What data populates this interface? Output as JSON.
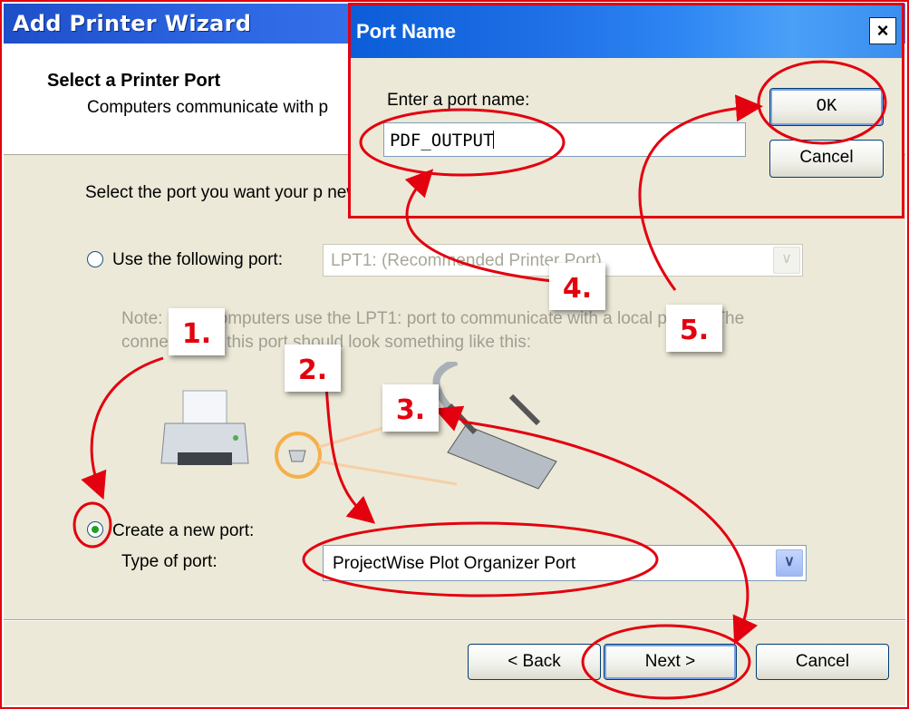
{
  "wizard": {
    "title": "Add Printer Wizard",
    "header_title": "Select a Printer Port",
    "header_subtitle": "Computers communicate with p",
    "instructions": "Select the port you want your p new port.",
    "use_port_label": "Use the following port:",
    "use_port_value": "LPT1: (Recommended Printer Port)",
    "note": "Note: Most computers use the LPT1: port to communicate with a local printer. The connector for this port should look something like this:",
    "create_port_label": "Create a new port:",
    "type_of_port_label": "Type of port:",
    "type_of_port_value": "ProjectWise Plot Organizer Port",
    "back_label": "< Back",
    "next_label": "Next >",
    "cancel_label": "Cancel"
  },
  "port_dialog": {
    "title": "Port Name",
    "close_label": "×",
    "prompt": "Enter a port name:",
    "input_value": "PDF_OUTPUT",
    "ok_label": "OK",
    "cancel_label": "Cancel"
  },
  "annotations": {
    "steps": [
      "1.",
      "2.",
      "3.",
      "4.",
      "5."
    ],
    "color": "#e3000f"
  },
  "colors": {
    "title_bar": "#2d66e2",
    "dialog_title_bar": "#1f6fe6",
    "face": "#ece9d8",
    "radio_selected": "#21a121"
  }
}
